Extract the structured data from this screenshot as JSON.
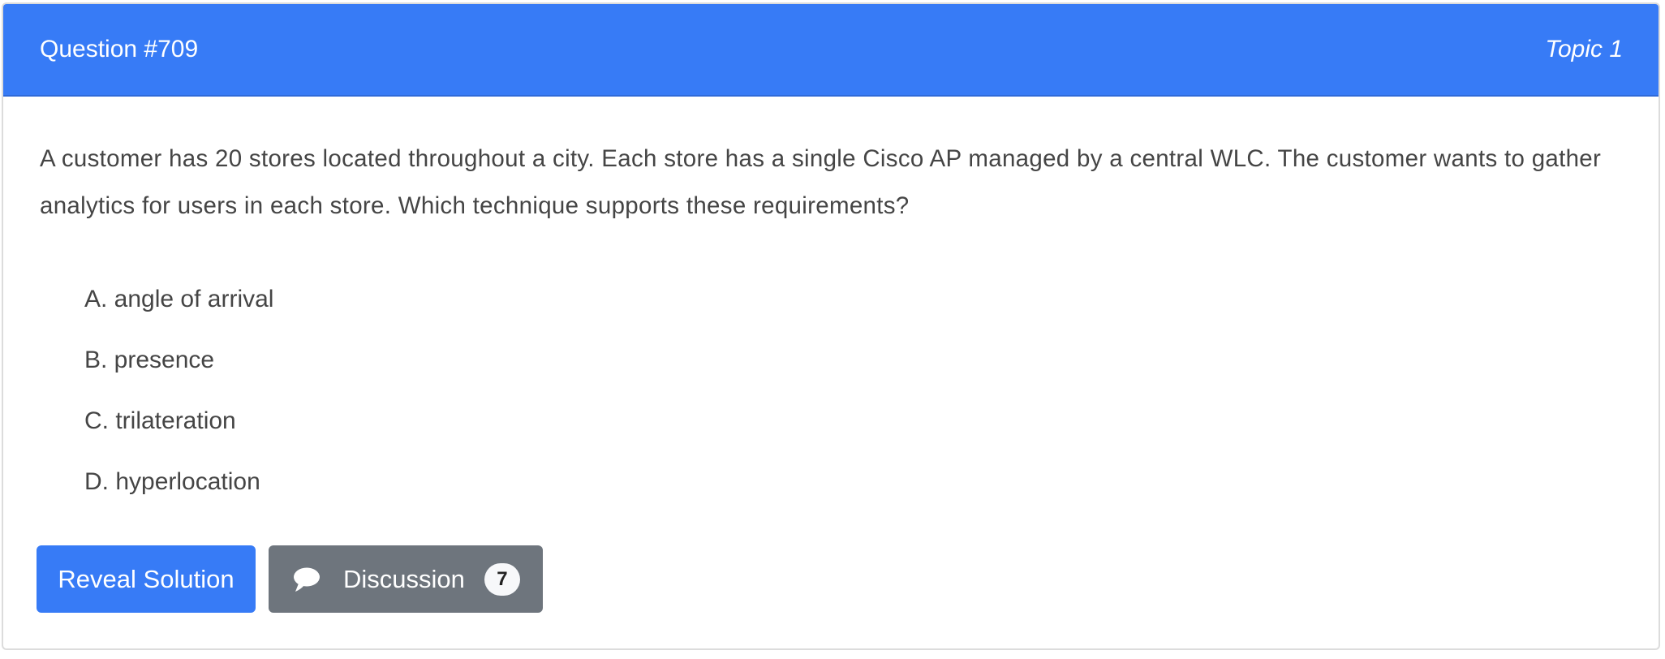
{
  "header": {
    "title": "Question #709",
    "topic": "Topic 1"
  },
  "question": {
    "text": "A customer has 20 stores located throughout a city. Each store has a single Cisco AP managed by a central WLC. The customer wants to gather analytics for users in each store. Which technique supports these requirements?"
  },
  "choices": [
    "A. angle of arrival",
    "B. presence",
    "C. trilateration",
    "D. hyperlocation"
  ],
  "buttons": {
    "reveal": "Reveal Solution",
    "discussion": "Discussion",
    "discussion_count": "7",
    "discussion_icon": "comment-icon"
  },
  "colors": {
    "primary": "#377bf6",
    "secondary": "#6e757d"
  }
}
